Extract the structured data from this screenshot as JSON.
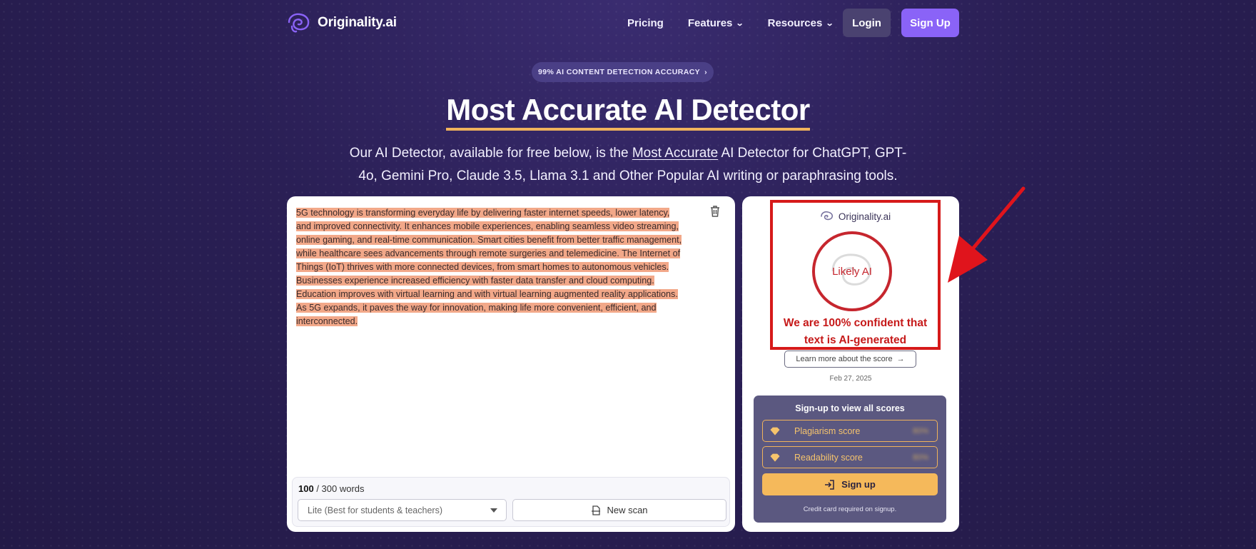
{
  "nav": {
    "brand": "Originality.ai",
    "links": [
      "Pricing",
      "Features",
      "Resources"
    ],
    "login": "Login",
    "signup": "Sign Up"
  },
  "hero": {
    "badge": "99% AI CONTENT DETECTION ACCURACY",
    "title": "Most Accurate AI Detector",
    "sub_before": "Our AI Detector, available for free below, is the ",
    "sub_link": "Most Accurate",
    "sub_after": " AI Detector for ChatGPT, GPT-4o, Gemini Pro, Claude 3.5, Llama 3.1 and Other Popular AI writing or paraphrasing tools."
  },
  "editor": {
    "text": "5G technology is transforming everyday life by delivering faster internet speeds, lower latency, and improved connectivity. It enhances mobile experiences, enabling seamless video streaming, online gaming, and real-time communication. Smart cities benefit from better traffic management, while healthcare sees advancements through remote surgeries and telemedicine. The Internet of Things (IoT) thrives with more connected devices, from smart homes to autonomous vehicles. Businesses experience increased efficiency with faster data transfer and cloud computing. Education improves with virtual learning and with virtual learning augmented reality applications. As 5G expands, it paves the way for innovation, making life more convenient, efficient, and interconnected.",
    "word_count": "100",
    "word_limit": "/ 300 words",
    "mode": "Lite (Best for students & teachers)",
    "new_scan": "New scan"
  },
  "result": {
    "brand": "Originality.ai",
    "verdict": "Likely AI",
    "confidence_line1": "We are 100% confident that",
    "confidence_line2": "text is AI-generated",
    "learn_more": "Learn more about the score",
    "date": "Feb 27, 2025"
  },
  "signup_panel": {
    "title": "Sign-up to view all scores",
    "rows": [
      {
        "label": "Plagiarism score",
        "value": "80%"
      },
      {
        "label": "Readability score",
        "value": "80%"
      }
    ],
    "button": "Sign up",
    "note": "Credit card required on signup."
  },
  "colors": {
    "accent_purple": "#8a63f7",
    "highlight_ai": "#f2a889",
    "alert_red": "#d61a1a",
    "gold": "#f5b95b"
  }
}
